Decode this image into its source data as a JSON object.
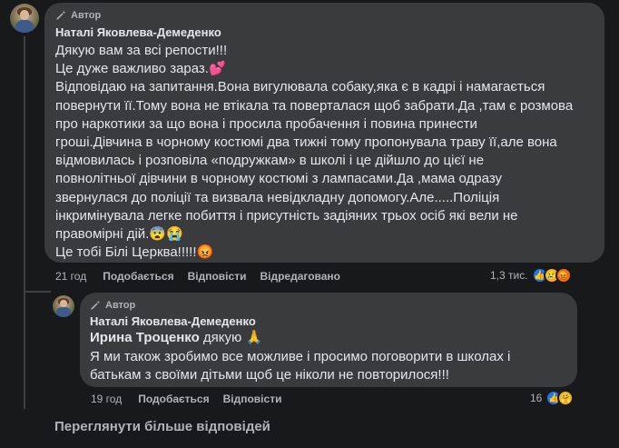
{
  "comment": {
    "badge": "Автор",
    "author": "Наталі Яковлева-Демеденко",
    "lines": [
      "Дякую вам за всі репости!!!",
      "Це дуже важливо зараз.💕",
      "Відповідаю на запитання.Вона вигулювала собаку,яка є в кадрі і намагається",
      "повернути її.Тому вона не втікала та поверталася щоб забрати.Да ,там є розмова",
      "про наркотики за що вона і просила пробачення і повина принести",
      "гроші.Дівчина в чорному костюмі два тижні тому пропонувала траву її,але вона",
      "відмовилась і розповіла «подружкам» в школі і це дійшло до цієї не",
      "повнолітньої дівчини в чорному костюмі з лампасами.Да ,мама одразу",
      "звернулася до поліції та визвала невідкладну допомогу.Але.....Поліція",
      "інкримінувала легке побиття і присутність задіяних трьох осіб які вели не",
      "правомірні дій.😨😭",
      "Це тобі Білі Церква!!!!!😡"
    ],
    "time": "21 год",
    "like_label": "Подобається",
    "reply_label": "Відповісти",
    "edited_label": "Відредаговано",
    "reaction_count": "1,3 тис."
  },
  "reply": {
    "badge": "Автор",
    "author": "Наталі Яковлева-Демеденко",
    "mention": "Ирина Троценко",
    "first_line_rest": "дякую 🙏",
    "lines": [
      "Я ми також зробимо все можливе і просимо поговорити в школах і",
      "батькам з своїми дітьми щоб це ніколи не повторилося!!!"
    ],
    "time": "19 год",
    "like_label": "Подобається",
    "reply_label": "Відповісти",
    "reaction_count": "16"
  },
  "more_replies_label": "Переглянути більше відповідей",
  "colors": {
    "background": "#18191a",
    "bubble": "#3a3b3c",
    "text": "#e4e6eb",
    "secondary": "#b0b3b8",
    "like_blue": "#1877f2"
  }
}
